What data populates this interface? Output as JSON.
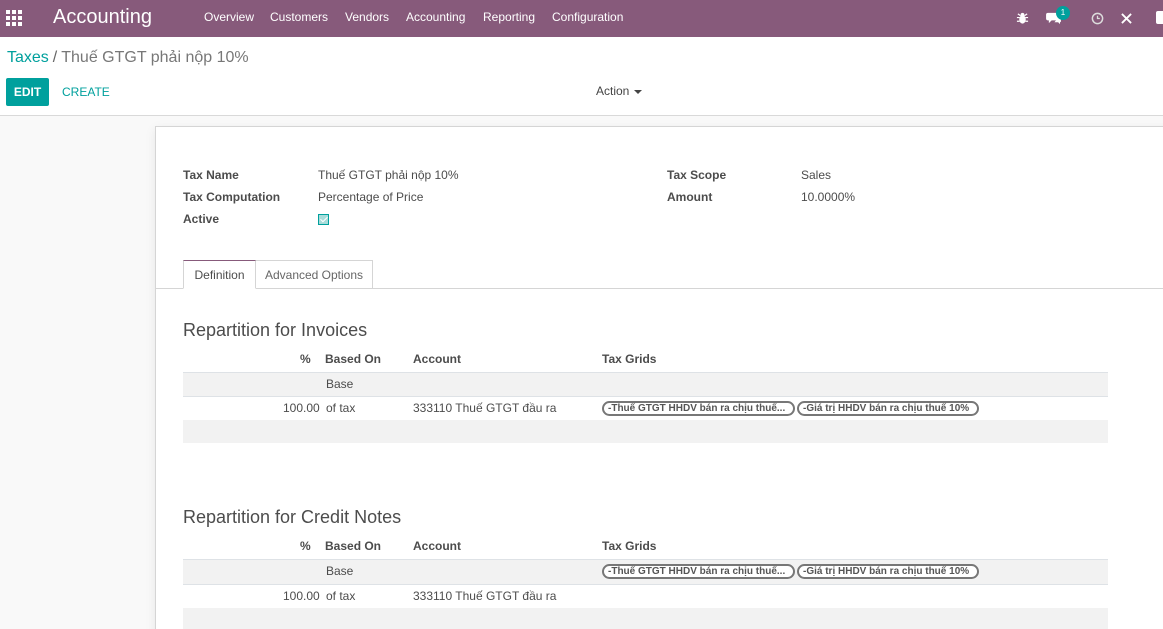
{
  "navbar": {
    "app_title": "Accounting",
    "menu": [
      "Overview",
      "Customers",
      "Vendors",
      "Accounting",
      "Reporting",
      "Configuration"
    ],
    "messages_badge": "1",
    "icons": [
      "apps-grid-icon",
      "bug-icon",
      "chat-icon",
      "clock-icon",
      "close-icon"
    ]
  },
  "breadcrumb": {
    "parent": "Taxes",
    "separator": "/",
    "current": "Thuế GTGT phải nộp 10%"
  },
  "buttons": {
    "edit": "EDIT",
    "create": "CREATE",
    "action": "Action"
  },
  "form": {
    "tax_name_label": "Tax Name",
    "tax_name": "Thuế GTGT phải nộp 10%",
    "tax_computation_label": "Tax Computation",
    "tax_computation": "Percentage of Price",
    "active_label": "Active",
    "active": true,
    "tax_scope_label": "Tax Scope",
    "tax_scope": "Sales",
    "amount_label": "Amount",
    "amount": "10.0000%"
  },
  "tabs": [
    "Definition",
    "Advanced Options"
  ],
  "invoices": {
    "title": "Repartition for Invoices",
    "headers": [
      "%",
      "Based On",
      "Account",
      "Tax Grids"
    ],
    "rows": [
      {
        "percent": "",
        "based_on": "Base",
        "account": "",
        "tags": []
      },
      {
        "percent": "100.00",
        "based_on": "of tax",
        "account": "333110 Thuế GTGT đầu ra",
        "tags": [
          "-Thuế GTGT HHDV bán ra chịu thuế...",
          "-Giá trị HHDV bán ra chịu thuế 10%"
        ]
      }
    ]
  },
  "credit_notes": {
    "title": "Repartition for Credit Notes",
    "headers": [
      "%",
      "Based On",
      "Account",
      "Tax Grids"
    ],
    "rows": [
      {
        "percent": "",
        "based_on": "Base",
        "account": "",
        "tags": [
          "-Thuế GTGT HHDV bán ra chịu thuế...",
          "-Giá trị HHDV bán ra chịu thuế 10%"
        ]
      },
      {
        "percent": "100.00",
        "based_on": "of tax",
        "account": "333110 Thuế GTGT đầu ra",
        "tags": []
      }
    ]
  },
  "colors": {
    "navbar": "#875a7b",
    "accent": "#00a09d"
  }
}
